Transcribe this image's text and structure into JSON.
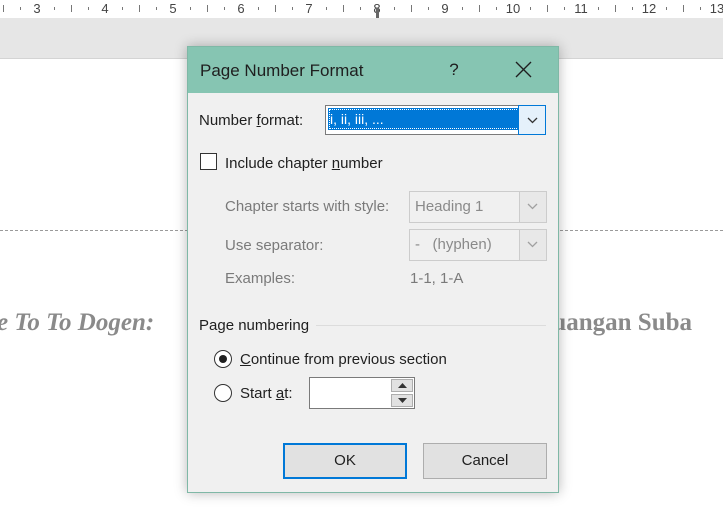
{
  "ruler": {
    "numbers": [
      "3",
      "4",
      "5",
      "6",
      "7",
      "8",
      "9",
      "10",
      "11",
      "12",
      "13"
    ]
  },
  "document": {
    "left_text": "e To To Dogen:",
    "right_text": "juangan Suba"
  },
  "dialog": {
    "title": "Page Number Format",
    "help_label": "?",
    "number_format": {
      "label_before": "Number ",
      "label_hotkey": "f",
      "label_after": "ormat:",
      "value": "i, ii, iii, ..."
    },
    "include_chapter": {
      "label_before": "Include chapter ",
      "label_hotkey": "n",
      "label_after": "umber",
      "checked": false
    },
    "chapter_style": {
      "label": "Chapter starts with style:",
      "value": "Heading 1"
    },
    "separator": {
      "label": "Use separator:",
      "value": "-   (hyphen)"
    },
    "examples": {
      "label": "Examples:",
      "value": "1-1, 1-A"
    },
    "page_numbering": {
      "group_label": "Page numbering",
      "continue": {
        "label_hotkey": "C",
        "label_after": "ontinue from previous section",
        "selected": true
      },
      "start_at": {
        "label_before": "Start ",
        "label_hotkey": "a",
        "label_after": "t:",
        "selected": false,
        "value": ""
      }
    },
    "buttons": {
      "ok": "OK",
      "cancel": "Cancel"
    }
  },
  "colors": {
    "titlebar": "#86c5b2",
    "selection": "#0078d7",
    "dialog_bg": "#f0f0f0"
  }
}
